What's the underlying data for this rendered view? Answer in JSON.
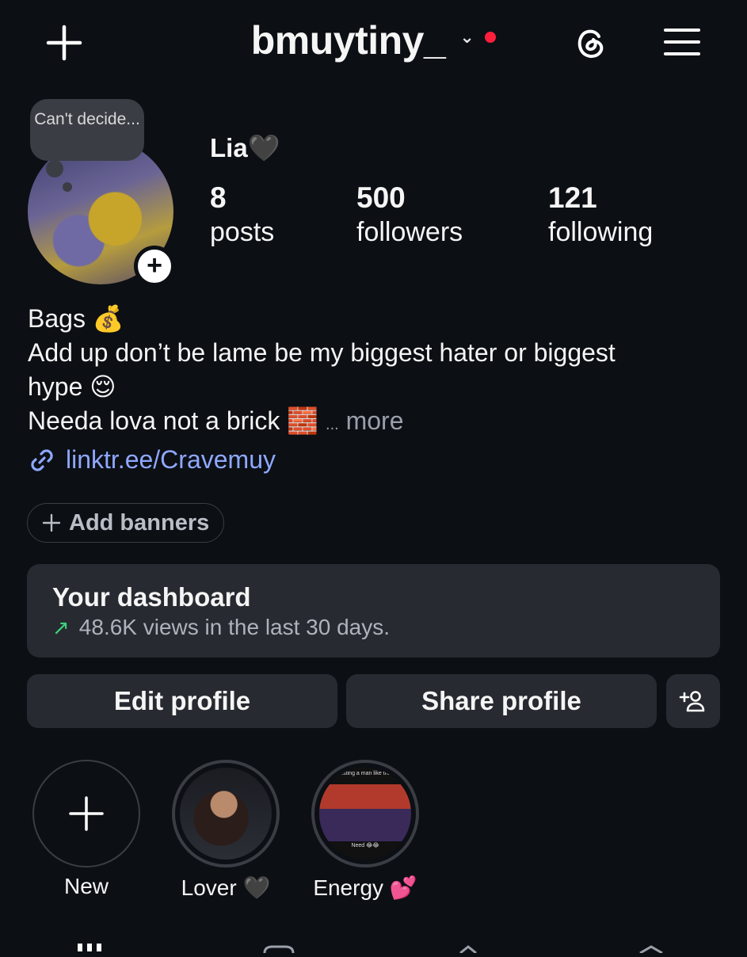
{
  "header": {
    "username": "bmuytiny_",
    "add_icon": "plus-icon",
    "threads_icon": "threads-icon",
    "menu_icon": "hamburger-menu-icon",
    "notification_dot_color": "#ff1f3d"
  },
  "profile": {
    "note_text": "Can't decide...",
    "display_name": "Lia🖤",
    "stats": [
      {
        "value": "8",
        "label": "posts"
      },
      {
        "value": "500",
        "label": "followers"
      },
      {
        "value": "121",
        "label": "following"
      }
    ],
    "bio": {
      "line1": "Bags 💰",
      "line2": "Add up don’t be lame be my biggest hater or biggest",
      "line3": "hype 😌",
      "line4": "Needa lova not a brick 🧱",
      "ellipsis": "...",
      "more": "more"
    },
    "link": "linktr.ee/Cravemuy"
  },
  "banners": {
    "label": "Add banners",
    "icon": "plus-icon"
  },
  "dashboard": {
    "title": "Your dashboard",
    "subtitle": "48.6K views in the last 30 days.",
    "trend_color": "#3dd27a"
  },
  "actions": {
    "edit": "Edit profile",
    "share": "Share profile",
    "discover_icon": "add-person-icon"
  },
  "highlights": [
    {
      "label": "New"
    },
    {
      "label": "Lover 🖤",
      "caption_text": "",
      "footer_text": ""
    },
    {
      "label": "Energy 💕",
      "caption_text": "...sting a man like this",
      "footer_text": "Need 😂😂"
    }
  ],
  "accent_link_color": "#8ea8ff"
}
